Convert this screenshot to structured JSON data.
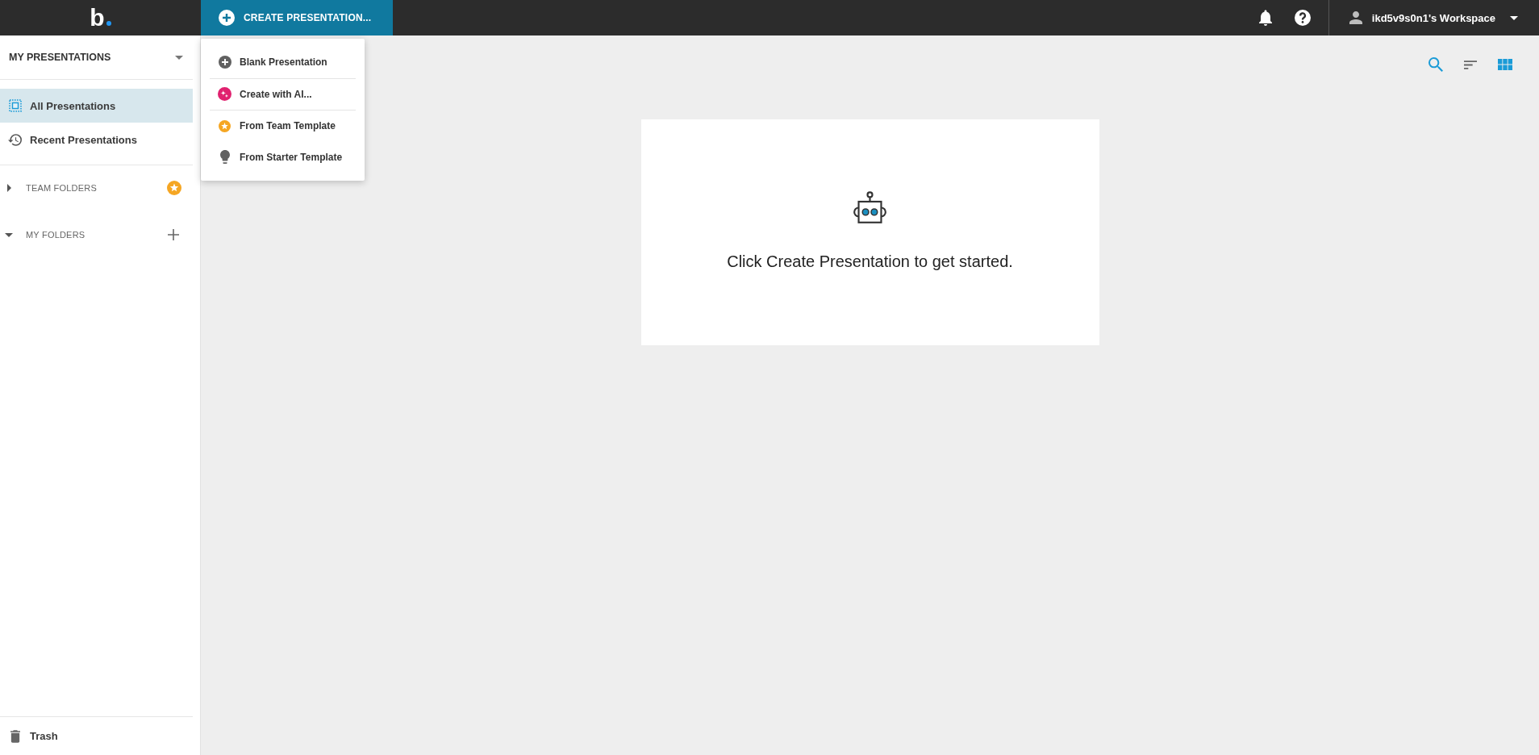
{
  "top_bar": {
    "logo": "b",
    "create_button": {
      "label": "CREATE PRESENTATION..."
    },
    "workspace": "ikd5v9s0n1's Workspace"
  },
  "create_menu": {
    "groups": [
      {
        "items": [
          {
            "kind": "blank",
            "label": "Blank Presentation"
          }
        ]
      },
      {
        "items": [
          {
            "kind": "ai",
            "label": "Create with AI..."
          }
        ]
      },
      {
        "items": [
          {
            "kind": "team",
            "label": "From Team Template"
          },
          {
            "kind": "starter",
            "label": "From Starter Template"
          }
        ]
      }
    ]
  },
  "sidebar": {
    "header": "MY PRESENTATIONS",
    "nav": [
      {
        "kind": "all",
        "label": "All Presentations",
        "selected": true
      },
      {
        "kind": "recent",
        "label": "Recent Presentations",
        "selected": false
      }
    ],
    "sections": [
      {
        "kind": "team",
        "label": "TEAM FOLDERS",
        "expanded": false
      },
      {
        "kind": "personal",
        "label": "MY FOLDERS",
        "expanded": true
      }
    ],
    "trash": "Trash"
  },
  "empty_state": {
    "message": "Click Create Presentation to get started."
  }
}
